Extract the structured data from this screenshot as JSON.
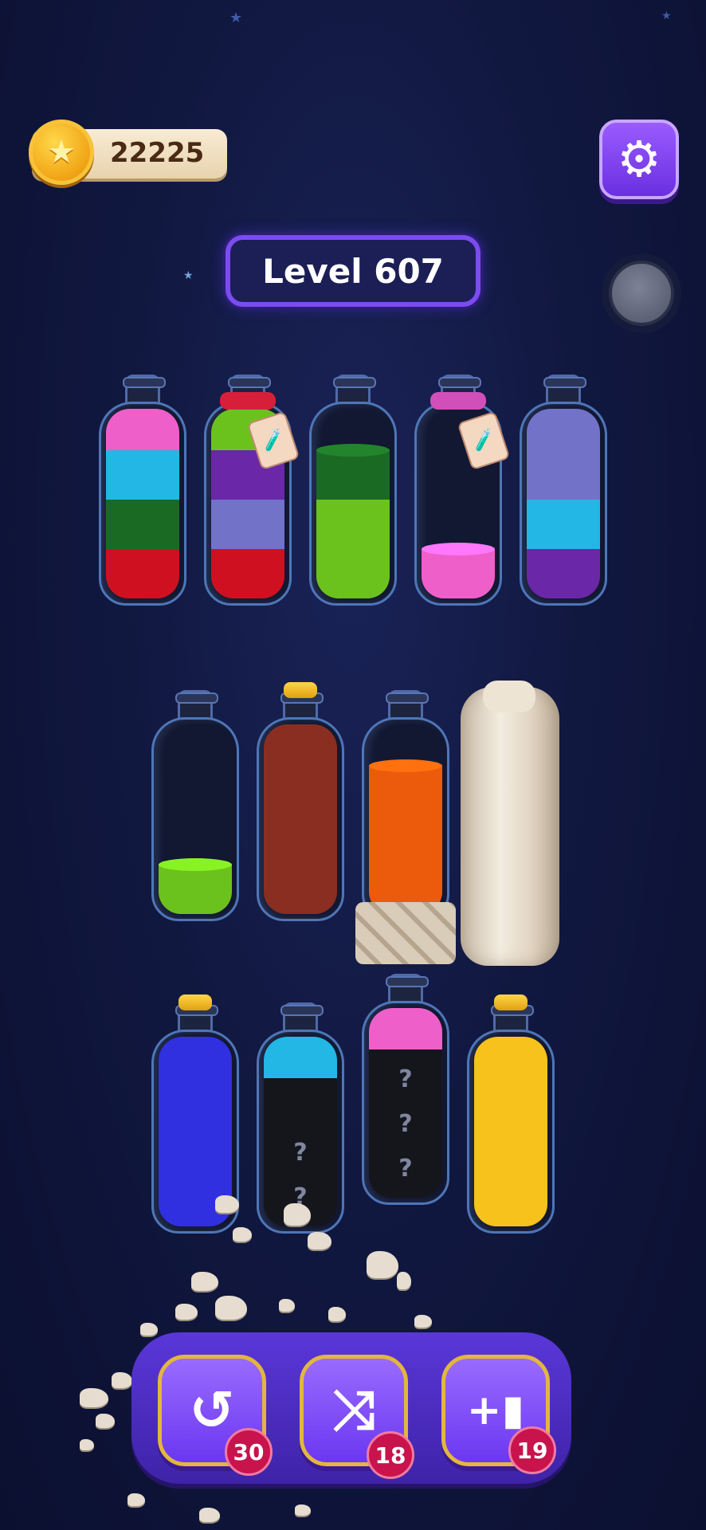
{
  "coins": {
    "value": "22225",
    "icon": "star-coin-icon"
  },
  "settings": {
    "icon": "gear-icon"
  },
  "level": {
    "label": "Level 607"
  },
  "colors": {
    "pink": "#ef5fc9",
    "cyan": "#23b7e6",
    "darkgreen": "#1b6a23",
    "red": "#cf1020",
    "lime": "#6cc21c",
    "purple": "#6a27a8",
    "lavender": "#7272c8",
    "brown": "#8a2e22",
    "orange": "#ec5a0c",
    "blue": "#3030e0",
    "yellow": "#f7c21c",
    "hidden": "#15161c"
  },
  "bottles_row1": [
    {
      "layers": [
        "red",
        "darkgreen",
        "cyan",
        "pink"
      ]
    },
    {
      "layers": [
        "red",
        "lavender",
        "purple",
        "lime"
      ],
      "locked": true,
      "tie": "red"
    },
    {
      "layers": [
        "lime",
        "lime",
        "darkgreen"
      ]
    },
    {
      "layers": [
        "pink"
      ],
      "locked": true,
      "tie": "pink"
    },
    {
      "layers": [
        "purple",
        "cyan",
        "lavender",
        "lavender"
      ]
    }
  ],
  "bottles_row2": [
    {
      "layers": [
        "lime"
      ]
    },
    {
      "layers": [
        "brown",
        "brown",
        "brown",
        "brown"
      ],
      "corked": true
    },
    {
      "layers": [
        "orange",
        "orange",
        "orange"
      ],
      "breaking": true
    },
    {
      "stone": true
    }
  ],
  "bottles_row3": [
    {
      "layers": [
        "blue",
        "blue",
        "blue",
        "blue"
      ],
      "corked": true
    },
    {
      "layers": [
        "hidden",
        "hidden",
        "hidden",
        "cyan"
      ],
      "hidden_marks": 2
    },
    {
      "layers": [
        "hidden",
        "hidden",
        "hidden",
        "pink"
      ],
      "hidden_marks": 3
    },
    {
      "layers": [
        "yellow",
        "yellow",
        "yellow",
        "yellow"
      ],
      "corked": true
    }
  ],
  "powerups": [
    {
      "name": "undo",
      "icon": "undo-icon",
      "glyph": "↺",
      "count": "30"
    },
    {
      "name": "shuffle",
      "icon": "shuffle-icon",
      "glyph": "⤨",
      "count": "18"
    },
    {
      "name": "add-bottle",
      "icon": "add-bottle-icon",
      "glyph": "+▮",
      "count": "19"
    }
  ]
}
